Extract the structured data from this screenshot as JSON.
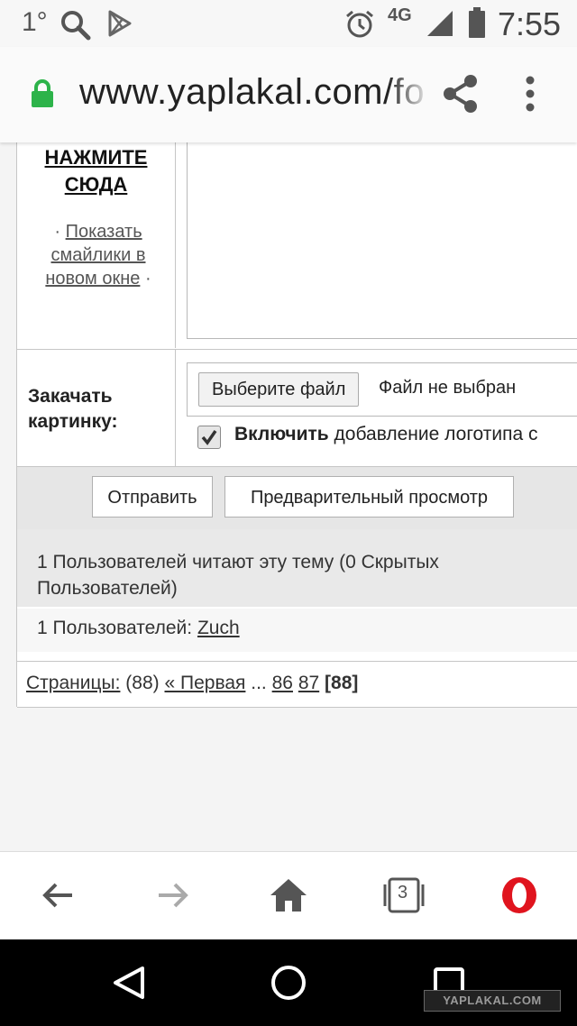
{
  "status_bar": {
    "temperature": "1°",
    "network": "4G",
    "time": "7:55"
  },
  "browser": {
    "url": "www.yaplakal.com/forum",
    "tab_count": "3"
  },
  "editor": {
    "click_here": "НАЖМИТЕ СЮДА",
    "show_smilies_link": "Показать смайлики в новом окне",
    "bullet": "·"
  },
  "upload": {
    "label": "Закачать картинку:",
    "choose_file_button": "Выберите файл",
    "no_file_text": "Файл не выбран",
    "logo_option_bold": "Включить",
    "logo_option_rest": "добавление логотипа с",
    "logo_checked": true
  },
  "actions": {
    "submit_label": "Отправить",
    "preview_label": "Предварительный просмотр"
  },
  "readers": {
    "text": "1 Пользователей читают эту тему (0 Скрытых Пользователей)",
    "users_prefix": "1 Пользователей:",
    "user_name": "Zuch"
  },
  "pagination": {
    "label": "Страницы:",
    "count": "(88)",
    "first": "« Первая",
    "ellipsis": "...",
    "pages": [
      "86",
      "87"
    ],
    "current": "[88]"
  },
  "watermark": "YAPLAKAL.COM",
  "colors": {
    "lock_green": "#2db34a",
    "opera_red": "#e0141e"
  }
}
